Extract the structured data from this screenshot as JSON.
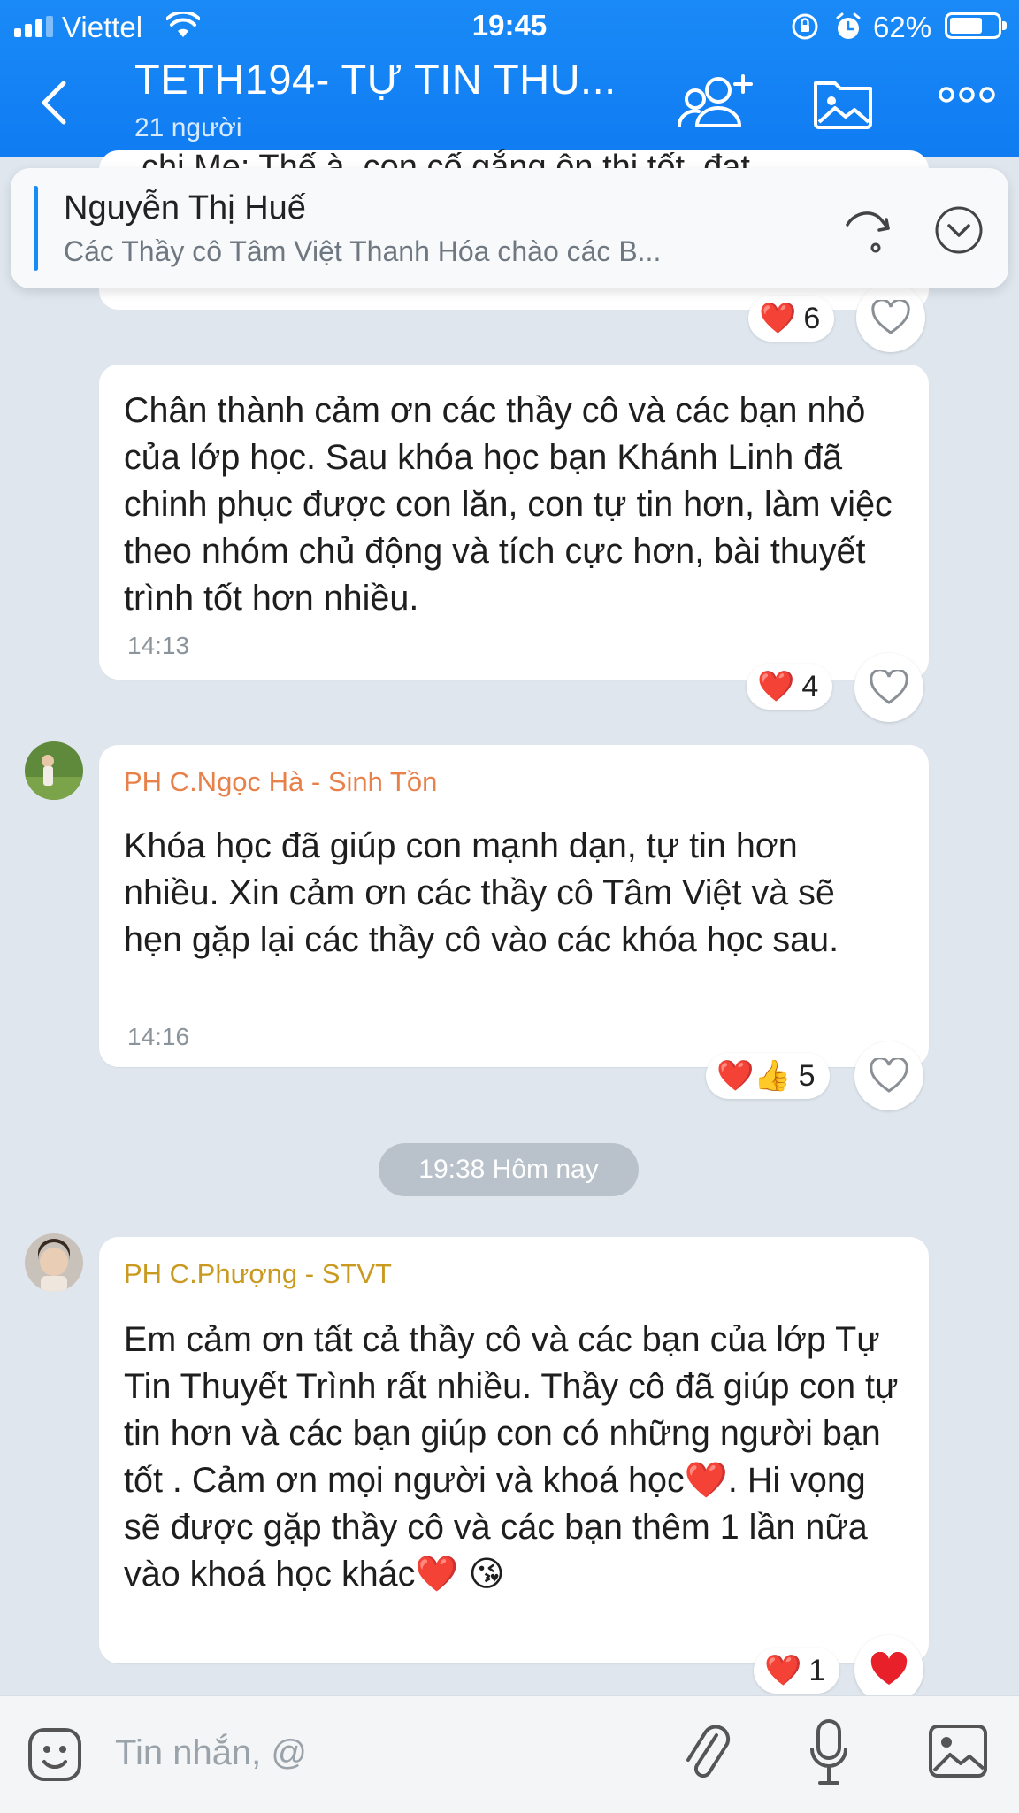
{
  "status_bar": {
    "carrier": "Viettel",
    "time": "19:45",
    "battery": "62%"
  },
  "header": {
    "title": "TETH194- TỰ TIN THU...",
    "subtitle": "21 người"
  },
  "pinned": {
    "name": "Nguyễn Thị Huế",
    "preview": "Các Thầy cô Tâm Việt Thanh Hóa chào các B..."
  },
  "partial_message": {
    "text": "chị Mẹ: Thế à, con cố gắng ôn thi tốt, đạt",
    "reactions": {
      "emoji": "❤️",
      "count": "6"
    }
  },
  "messages": [
    {
      "sender": "",
      "text": "Chân thành cảm ơn các thầy cô và các bạn nhỏ của lớp học. Sau khóa học bạn Khánh Linh đã chinh phục được con lăn, con tự tin hơn, làm việc theo nhóm chủ động và tích cực hơn, bài thuyết trình tốt hơn nhiều.",
      "time": "14:13",
      "reactions": {
        "emoji": "❤️",
        "count": "4"
      }
    },
    {
      "sender": "PH C.Ngọc Hà - Sinh Tồn",
      "text": "Khóa học đã giúp con mạnh dạn, tự tin hơn nhiều. Xin cảm ơn các thầy cô Tâm Việt và sẽ hẹn gặp lại các thầy cô vào các khóa học sau.",
      "time": "14:16",
      "reactions": {
        "emoji": "❤️👍",
        "count": "5"
      }
    },
    {
      "sender": "PH C.Phượng - STVT",
      "text": "Em cảm ơn tất cả thầy cô và các bạn của lớp Tự Tin Thuyết Trình rất nhiều. Thầy cô đã giúp con tự tin hơn và các bạn giúp con có những người bạn tốt . Cảm ơn mọi người và khoá học❤️. Hi vọng sẽ được gặp thầy cô và các bạn thêm 1 lần nữa vào khoá học khác❤️ 😘",
      "time": "",
      "reactions": {
        "emoji": "❤️",
        "count": "1"
      }
    }
  ],
  "date_divider": "19:38 Hôm nay",
  "input": {
    "placeholder": "Tin nhắn, @"
  },
  "colors": {
    "header_blue": "#1a8af7",
    "sender_orange": "#e8804a",
    "sender_gold": "#c99a1f",
    "heart_red": "#e8202a"
  }
}
